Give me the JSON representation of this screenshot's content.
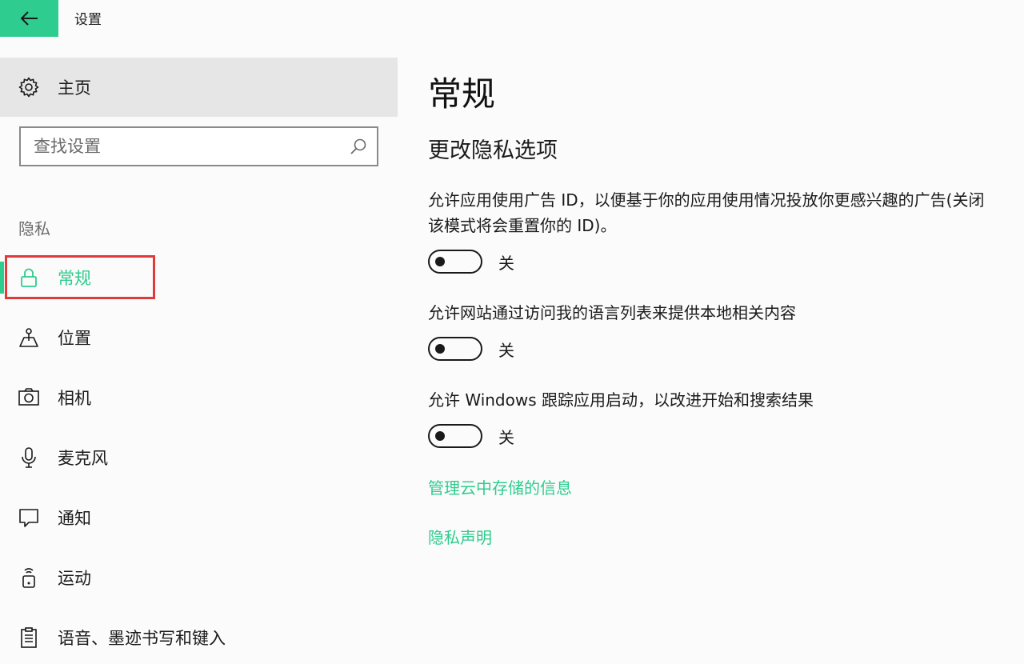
{
  "window": {
    "title": "设置",
    "back_icon": "arrow-left-icon",
    "accent_color": "#2ecc8e"
  },
  "sidebar": {
    "home": {
      "label": "主页",
      "icon": "gear-icon"
    },
    "search": {
      "placeholder": "查找设置",
      "value": "",
      "icon": "search-icon"
    },
    "section_label": "隐私",
    "items": [
      {
        "label": "常规",
        "icon": "lock-icon",
        "active": true
      },
      {
        "label": "位置",
        "icon": "location-icon",
        "active": false
      },
      {
        "label": "相机",
        "icon": "camera-icon",
        "active": false
      },
      {
        "label": "麦克风",
        "icon": "microphone-icon",
        "active": false
      },
      {
        "label": "通知",
        "icon": "notification-icon",
        "active": false
      },
      {
        "label": "运动",
        "icon": "motion-icon",
        "active": false
      },
      {
        "label": "语音、墨迹书写和键入",
        "icon": "clipboard-icon",
        "active": false
      }
    ]
  },
  "main": {
    "title": "常规",
    "section_title": "更改隐私选项",
    "settings": [
      {
        "description": "允许应用使用广告 ID，以便基于你的应用使用情况投放你更感兴趣的广告(关闭该模式将会重置你的 ID)。",
        "state": "关",
        "on": false
      },
      {
        "description": "允许网站通过访问我的语言列表来提供本地相关内容",
        "state": "关",
        "on": false
      },
      {
        "description": "允许 Windows 跟踪应用启动，以改进开始和搜索结果",
        "state": "关",
        "on": false
      }
    ],
    "links": [
      {
        "label": "管理云中存储的信息"
      },
      {
        "label": "隐私声明"
      }
    ]
  }
}
